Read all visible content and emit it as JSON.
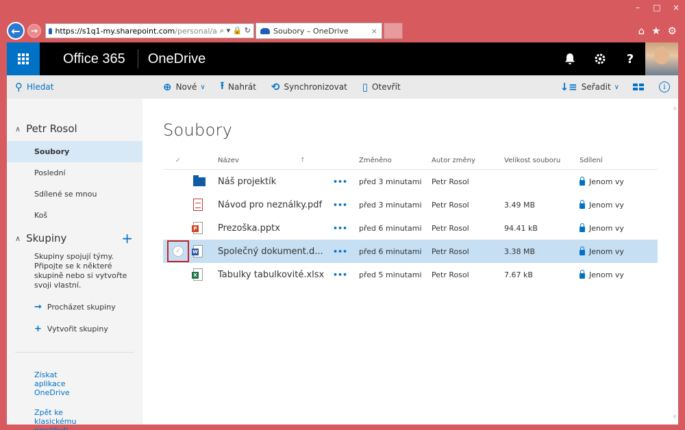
{
  "browser": {
    "url_main": "https://s1q1-my.sharepoint.com",
    "url_rest": "/personal/a",
    "tab_title": "Soubory – OneDrive"
  },
  "suite": {
    "brand": "Office 365",
    "app": "OneDrive",
    "notifications_icon": "bell-icon",
    "settings_icon": "gear-icon",
    "help_label": "?"
  },
  "commands": {
    "search": "Hledat",
    "new": "Nové",
    "upload": "Nahrát",
    "sync": "Synchronizovat",
    "open": "Otevřít",
    "sort": "Seřadit"
  },
  "sidebar": {
    "user_section": "Petr Rosol",
    "items": [
      {
        "label": "Soubory",
        "selected": true
      },
      {
        "label": "Poslední",
        "selected": false
      },
      {
        "label": "Sdílené se mnou",
        "selected": false
      },
      {
        "label": "Koš",
        "selected": false
      }
    ],
    "groups_section": "Skupiny",
    "groups_description": "Skupiny spojují týmy. Připojte se k některé skupině nebo si vytvořte svoji vlastní.",
    "browse_groups": "Procházet skupiny",
    "create_group": "Vytvořit skupiny",
    "get_apps": "Získat aplikace OneDrive",
    "classic": "Zpět ke klasickému prostředí OneDrivu"
  },
  "main": {
    "title": "Soubory",
    "columns": {
      "name": "Název",
      "modified": "Změněno",
      "author": "Autor změny",
      "size": "Velikost souboru",
      "sharing": "Sdílení"
    },
    "files": [
      {
        "type": "folder",
        "name": "Náš projektík",
        "dots": "•••",
        "modified": "před 3 minutami",
        "author": "Petr Rosol",
        "size": "",
        "sharing": "Jenom vy"
      },
      {
        "type": "pdf",
        "name": "Návod pro neználky.pdf",
        "dots": "•••",
        "modified": "před 3 minutami",
        "author": "Petr Rosol",
        "size": "3.49 MB",
        "sharing": "Jenom vy"
      },
      {
        "type": "pptx",
        "name": "Prezoška.pptx",
        "dots": "•••",
        "modified": "před 6 minutami",
        "author": "Petr Rosol",
        "size": "94.41 kB",
        "sharing": "Jenom vy"
      },
      {
        "type": "docx",
        "name": "Společný dokument.d...",
        "dots": "•••",
        "modified": "před 6 minutami",
        "author": "Petr Rosol",
        "size": "3.38 MB",
        "sharing": "Jenom vy",
        "selected": true
      },
      {
        "type": "xlsx",
        "name": "Tabulky tabulkovité.xlsx",
        "dots": "•••",
        "modified": "před 5 minutami",
        "author": "Petr Rosol",
        "size": "7.67 kB",
        "sharing": "Jenom vy"
      }
    ]
  },
  "colors": {
    "accent": "#0072c6",
    "window_frame": "#d65a5e",
    "selected_row": "#c6dff3",
    "highlight_box": "#c0242a"
  }
}
